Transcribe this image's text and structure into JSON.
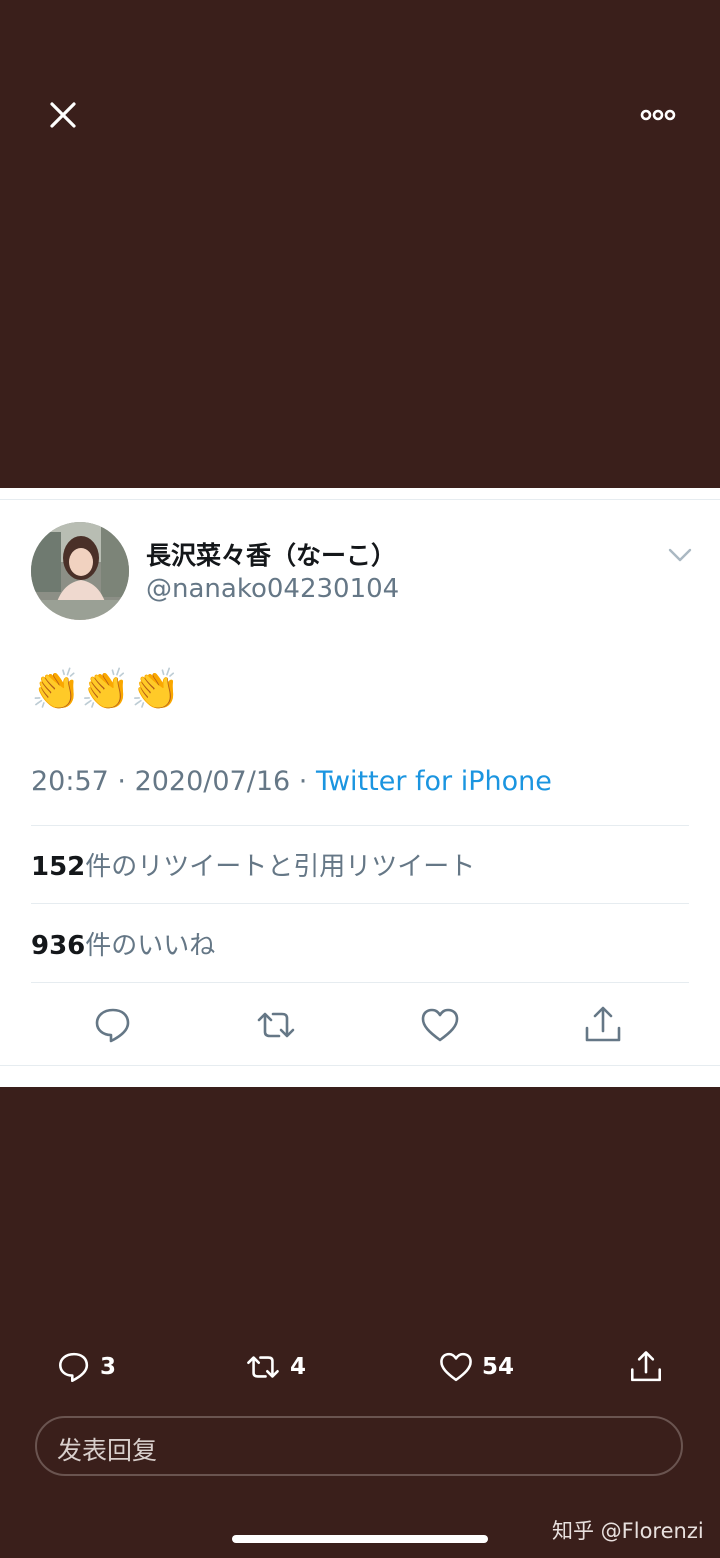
{
  "viewer": {
    "close_icon": "close-icon",
    "more_icon": "more-horizontal-icon"
  },
  "tweet": {
    "display_name": "長沢菜々香（なーこ）",
    "username": "@nanako04230104",
    "text": "👏👏👏",
    "time": "20:57",
    "date": "2020/07/16",
    "source": "Twitter for iPhone",
    "meta_separator": " · ",
    "retweets_count": "152",
    "retweets_label": "件のリツイートと引用リツイート",
    "likes_count": "936",
    "likes_label": "件のいいね",
    "actions": [
      "reply-icon",
      "retweet-icon",
      "like-icon",
      "share-icon"
    ]
  },
  "bottom_bar": {
    "reply_count": "3",
    "retweet_count": "4",
    "like_count": "54",
    "reply_placeholder": "发表回复"
  },
  "watermark": "知乎 @Florenzi",
  "colors": {
    "background": "#3a1f1b",
    "card": "#ffffff",
    "link": "#1b95e0",
    "secondary_text": "#657786"
  }
}
